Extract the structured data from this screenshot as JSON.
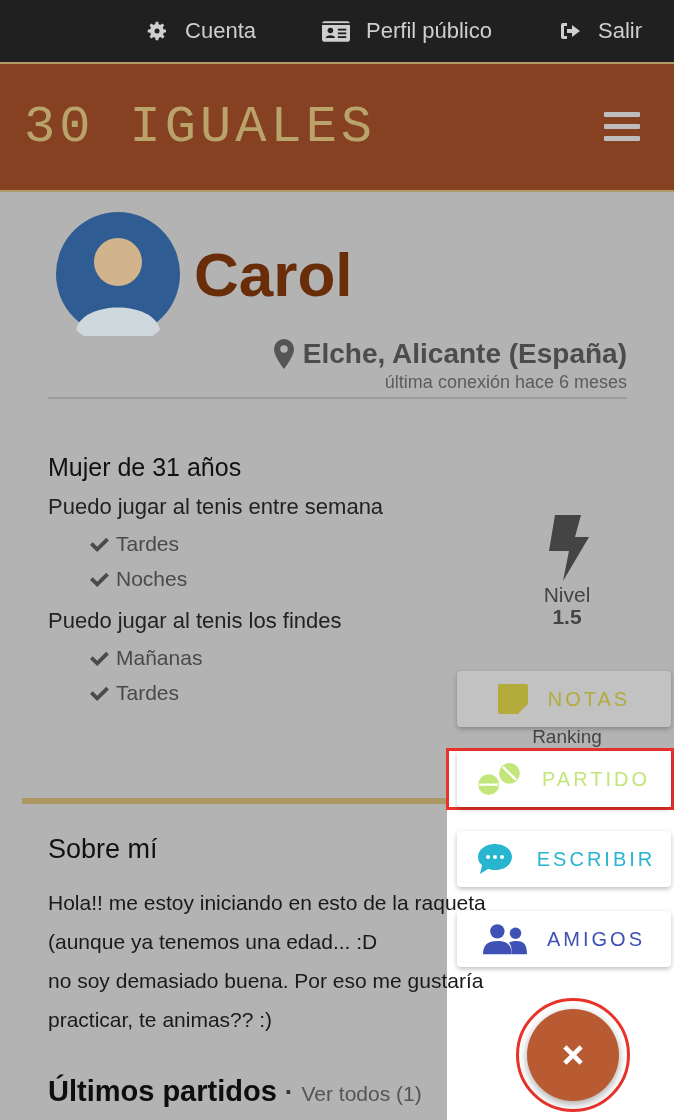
{
  "top_nav": [
    {
      "kind": "gear",
      "label": "Cuenta"
    },
    {
      "kind": "id-card",
      "label": "Perfil público"
    },
    {
      "kind": "sign-out",
      "label": "Salir"
    }
  ],
  "header": {
    "logo": "30 IGUALES"
  },
  "profile": {
    "name": "Carol",
    "location": "Elche, Alicante (España)",
    "last_seen": "última conexión hace 6 meses"
  },
  "info": {
    "title": "Mujer de 31 años",
    "availability": [
      {
        "label": "Puedo jugar al tenis entre semana",
        "slots": [
          {
            "label": "Tardes",
            "checked": true
          },
          {
            "label": "Noches",
            "checked": true
          }
        ]
      },
      {
        "label": "Puedo jugar al tenis los findes",
        "slots": [
          {
            "label": "Mañanas",
            "checked": true
          },
          {
            "label": "Tardes",
            "checked": true
          }
        ]
      }
    ],
    "level": {
      "label": "Nivel",
      "value": "1.5"
    },
    "ranking_label": "Ranking"
  },
  "about": {
    "title": "Sobre mí",
    "lines": [
      "Hola!! me estoy iniciando en esto de la raqueta",
      "(aunque ya tenemos una edad... :D",
      "no soy demasiado buena. Por eso me gustaría",
      "practicar, te animas?? :)"
    ]
  },
  "matches": {
    "title": "Últimos partidos",
    "separator": "·",
    "link": "Ver todos (1)"
  },
  "fab_menu": {
    "actions": [
      {
        "kind": "notes",
        "label": "NOTAS",
        "color": "#b3ab3c",
        "spotlit": false,
        "marked": false
      },
      {
        "kind": "match",
        "label": "PARTIDO",
        "color": "#c3e67a",
        "spotlit": true,
        "marked": true
      },
      {
        "kind": "chat",
        "label": "ESCRIBIR",
        "color": "#27b5d0",
        "spotlit": true,
        "marked": false
      },
      {
        "kind": "friends",
        "label": "AMIGOS",
        "color": "#3f51b5",
        "spotlit": true,
        "marked": false
      }
    ],
    "close": {
      "marked": true
    }
  }
}
